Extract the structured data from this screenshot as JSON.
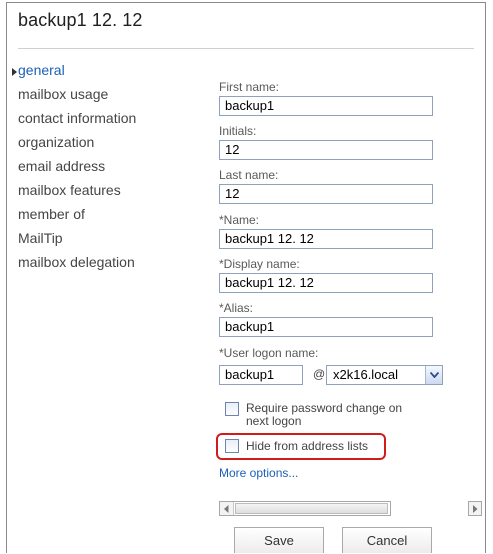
{
  "title": "backup1 12. 12",
  "nav": {
    "items": [
      {
        "label": "general",
        "active": true
      },
      {
        "label": "mailbox usage",
        "active": false
      },
      {
        "label": "contact information",
        "active": false
      },
      {
        "label": "organization",
        "active": false
      },
      {
        "label": "email address",
        "active": false
      },
      {
        "label": "mailbox features",
        "active": false
      },
      {
        "label": "member of",
        "active": false
      },
      {
        "label": "MailTip",
        "active": false
      },
      {
        "label": "mailbox delegation",
        "active": false
      }
    ]
  },
  "form": {
    "first_name": {
      "label": "First name:",
      "value": "backup1"
    },
    "initials": {
      "label": "Initials:",
      "value": "12"
    },
    "last_name": {
      "label": "Last name:",
      "value": "12"
    },
    "name": {
      "label": "*Name:",
      "value": "backup1 12. 12"
    },
    "display_name": {
      "label": "*Display name:",
      "value": "backup1 12. 12"
    },
    "alias": {
      "label": "*Alias:",
      "value": "backup1"
    },
    "logon": {
      "label": "*User logon name:",
      "value": "backup1",
      "at": "@",
      "domain": "x2k16.local"
    },
    "require_password_change": {
      "label": "Require password change on next logon",
      "checked": false
    },
    "hide_from_address_lists": {
      "label": "Hide from address lists",
      "checked": false
    },
    "more_options": "More options..."
  },
  "buttons": {
    "save": "Save",
    "cancel": "Cancel"
  },
  "colors": {
    "link": "#1c5fb8",
    "highlight": "#d11c1c",
    "input_border": "#8ea2bd"
  }
}
